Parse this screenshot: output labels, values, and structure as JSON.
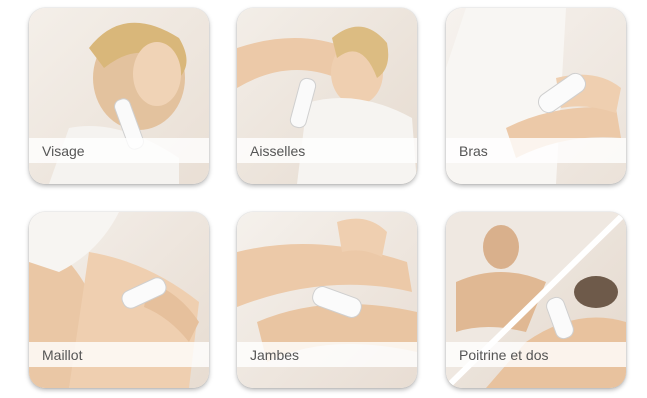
{
  "zones": [
    {
      "label": "Visage"
    },
    {
      "label": "Aisselles"
    },
    {
      "label": "Bras"
    },
    {
      "label": "Maillot"
    },
    {
      "label": "Jambes"
    },
    {
      "label": "Poitrine et dos"
    }
  ]
}
